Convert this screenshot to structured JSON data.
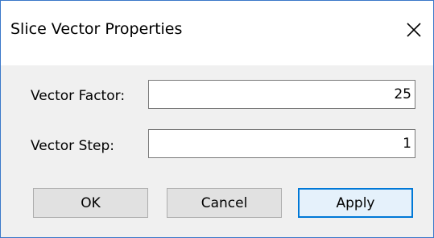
{
  "window": {
    "title": "Slice Vector Properties",
    "close_glyph": "close-icon"
  },
  "form": {
    "vector_factor": {
      "label": "Vector Factor:",
      "value": "25"
    },
    "vector_step": {
      "label": "Vector Step:",
      "value": "1"
    }
  },
  "buttons": {
    "ok": "OK",
    "cancel": "Cancel",
    "apply": "Apply"
  },
  "colors": {
    "window_border": "#3a78c9",
    "dialog_background": "#f0f0f0",
    "default_button_border": "#0078d7"
  }
}
